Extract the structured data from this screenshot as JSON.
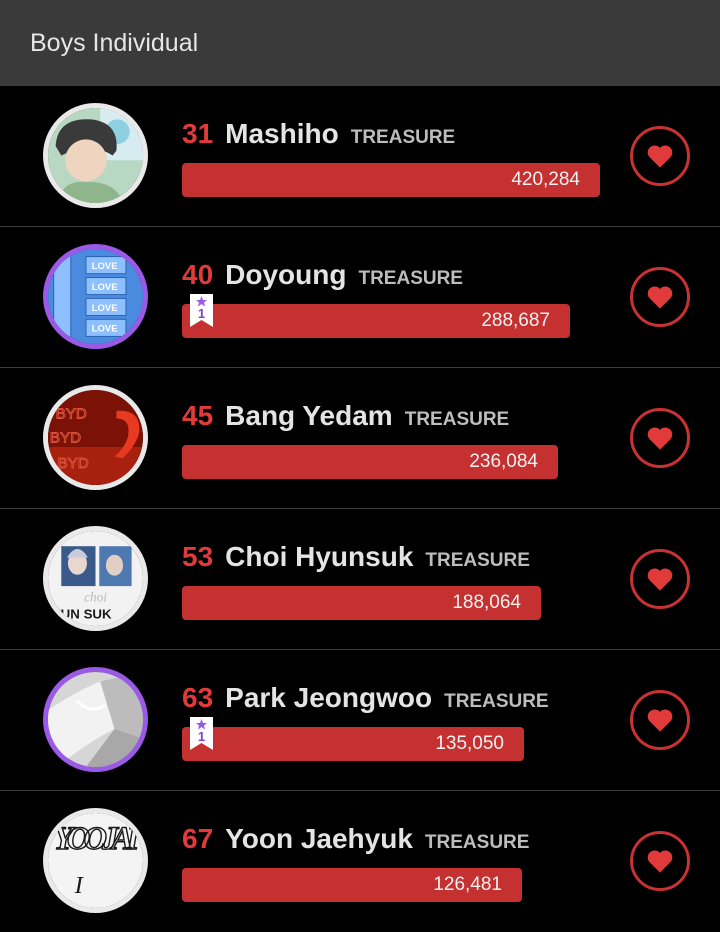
{
  "header": {
    "title": "Boys Individual"
  },
  "rankings": [
    {
      "rank": "31",
      "name": "Mashiho",
      "group": "TREASURE",
      "votes": "420,284",
      "votes_fraction": 1.0,
      "badge": null,
      "avatar_ring": "white",
      "avatar": "photo-avatar"
    },
    {
      "rank": "40",
      "name": "Doyoung",
      "group": "TREASURE",
      "votes": "288,687",
      "votes_fraction": 0.93,
      "badge": "1",
      "avatar_ring": "purple",
      "avatar": "love-pattern-avatar"
    },
    {
      "rank": "45",
      "name": "Bang Yedam",
      "group": "TREASURE",
      "votes": "236,084",
      "votes_fraction": 0.89,
      "badge": null,
      "avatar_ring": "white",
      "avatar": "byd-avatar"
    },
    {
      "rank": "53",
      "name": "Choi Hyunsuk",
      "group": "TREASURE",
      "votes": "188,064",
      "votes_fraction": 0.85,
      "badge": null,
      "avatar_ring": "white",
      "avatar": "hyunsuk-avatar"
    },
    {
      "rank": "63",
      "name": "Park Jeongwoo",
      "group": "TREASURE",
      "votes": "135,050",
      "votes_fraction": 0.82,
      "badge": "1",
      "avatar_ring": "purple",
      "avatar": "fabric-avatar"
    },
    {
      "rank": "67",
      "name": "Yoon Jaehyuk",
      "group": "TREASURE",
      "votes": "126,481",
      "votes_fraction": 0.81,
      "badge": null,
      "avatar_ring": "white",
      "avatar": "yoon-jae-avatar"
    }
  ],
  "avatar_art": {
    "row_1": "",
    "row_2": "LOVE",
    "row_3": "BYD",
    "row_4": "YUN SUK",
    "row_5": "",
    "row_6": "YOO JAI"
  },
  "colors": {
    "accent": "#c53030",
    "rank": "#e03a3a",
    "purple_ring": "#9b59e8",
    "header_bg": "#3a3a3a"
  },
  "icons": {
    "vote": "heart-icon",
    "badge": "bookmark-star-icon"
  }
}
